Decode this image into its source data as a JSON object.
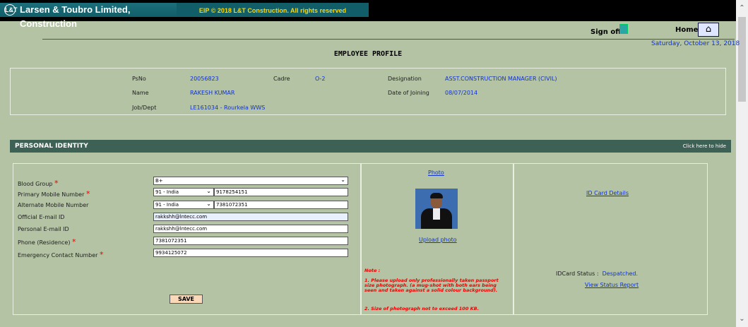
{
  "header": {
    "logo_glyph": "L&T",
    "company": "Larsen & Toubro Limited, Construction",
    "copyright": "EIP © 2018 L&T Construction. All rights reserved",
    "sign_off": "Sign off",
    "home": "Home",
    "home_icon": "⌂",
    "date": "Saturday, October 13, 2018"
  },
  "page_title": "EMPLOYEE PROFILE",
  "employee": {
    "psno_label": "PsNo",
    "psno": "20056823",
    "cadre_label": "Cadre",
    "cadre": "O-2",
    "designation_label": "Designation",
    "designation": "ASST.CONSTRUCTION MANAGER (CIVIL)",
    "name_label": "Name",
    "name": "RAKESH KUMAR",
    "doj_label": "Date of Joining",
    "doj": "08/07/2014",
    "dept_label": "Job/Dept",
    "dept": "LE161034 - Rourkela WWS"
  },
  "section": {
    "title": "PERSONAL IDENTITY",
    "hide": "Click here to hide"
  },
  "form": {
    "blood_group_label": "Blood Group",
    "blood_group": "B+",
    "primary_mobile_label": "Primary Mobile Number",
    "primary_code": "91 - India",
    "primary_mobile": "9178254151",
    "alt_mobile_label": "Alternate Mobile Number",
    "alt_code": "91 - India",
    "alt_mobile": "7381072351",
    "official_email_label": "Official E-mail ID",
    "official_email": "rakkshh@lntecc.com",
    "personal_email_label": "Personal E-mail ID",
    "personal_email": "rakkshh@lntecc.com",
    "phone_label": "Phone (Residence)",
    "phone": "7381072351",
    "emergency_label": "Emergency Contact Number",
    "emergency": "9934125072",
    "required_mark": "*",
    "save": "SAVE"
  },
  "photo_panel": {
    "photo_link": "Photo",
    "upload_link": "Upload photo",
    "note_title": "Note :",
    "note_1": "1. Please upload only professionally taken passport size photograph. (a mug-shot with both ears being seen and taken against a solid colour background).",
    "note_2": "2. Size of photograph not to exceed 100 KB."
  },
  "id_panel": {
    "details_link": "ID Card Details",
    "status_label": "IDCard Status :",
    "status_value": "Despatched.",
    "report_link": "View Status Report"
  },
  "icons": {
    "dropdown": "chevron-down-icon",
    "home": "home-icon",
    "sign_off": "door-icon"
  }
}
